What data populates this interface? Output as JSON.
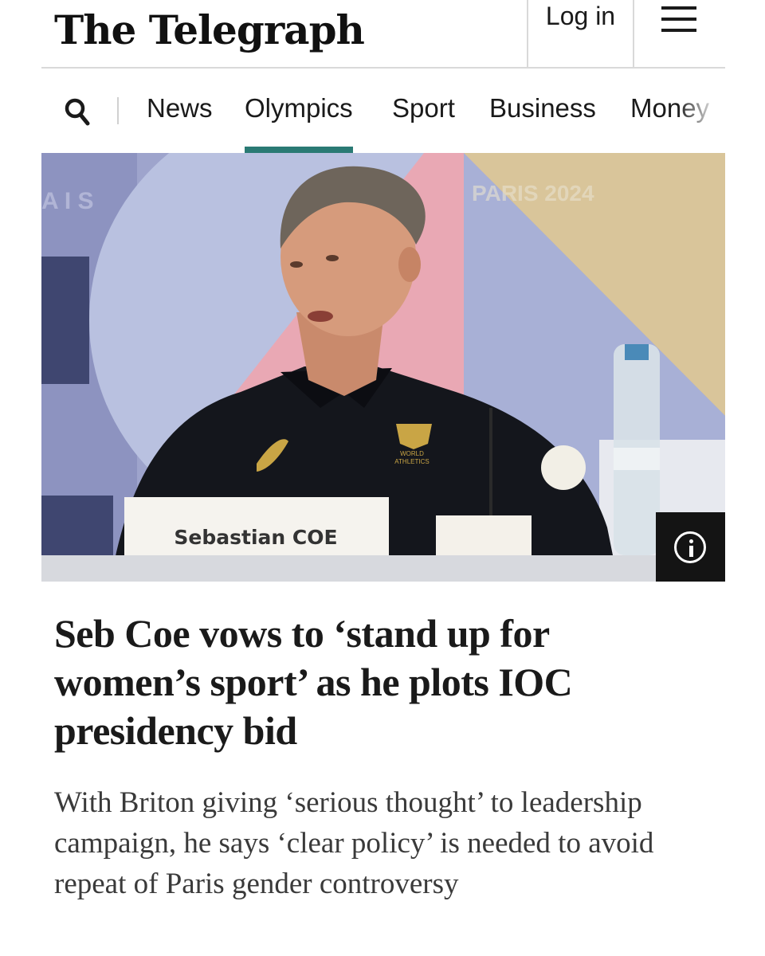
{
  "header": {
    "logo_text": "The Telegraph",
    "login_label": "Log in",
    "menu_icon": "hamburger-menu-icon"
  },
  "nav": {
    "search_icon": "search-icon",
    "items": [
      {
        "label": "News",
        "active": false
      },
      {
        "label": "Olympics",
        "active": true
      },
      {
        "label": "Sport",
        "active": false
      },
      {
        "label": "Business",
        "active": false
      },
      {
        "label": "Money",
        "active": false
      }
    ],
    "active_color": "#2a7a74"
  },
  "hero": {
    "nameplate_text": "Sebastian COE",
    "shirt_logo_text": "WORLD ATHLETICS",
    "info_icon": "info-icon"
  },
  "article": {
    "headline": "Seb Coe vows to ‘stand up for women’s sport’ as he plots IOC presidency bid",
    "standfirst": "With Briton giving ‘serious thought’ to leadership campaign, he says ‘clear policy’ is needed to avoid repeat of Paris gender controversy"
  }
}
